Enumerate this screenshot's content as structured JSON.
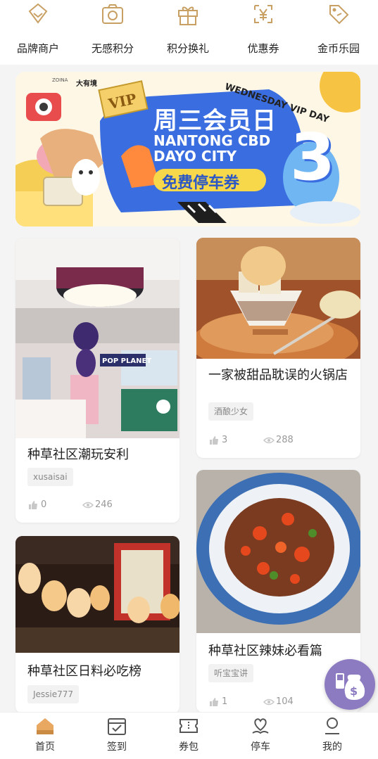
{
  "quick_nav": [
    {
      "label": "品牌商户",
      "icon": "diamond-icon"
    },
    {
      "label": "无感积分",
      "icon": "camera-icon"
    },
    {
      "label": "积分换礼",
      "icon": "gift-icon"
    },
    {
      "label": "优惠券",
      "icon": "yen-coupon-icon"
    },
    {
      "label": "金币乐园",
      "icon": "tag-icon"
    }
  ],
  "banner": {
    "brand_left": "ZOINA",
    "brand_right": "大有境",
    "vip_badge": "VIP",
    "title_cn": "周三会员日",
    "title_en_line1": "NANTONG CBD",
    "title_en_line2": "DAYO CITY",
    "cta": "免费停车券",
    "arc_text": "WEDNESDAY VIP DAY",
    "big_number": "3"
  },
  "posts": [
    {
      "title": "种草社区潮玩安利",
      "author": "xusaisai",
      "likes": "0",
      "views": "246",
      "sign_text": "POP PLANET"
    },
    {
      "title": "一家被甜品耽误的火锅店",
      "author": "酒酿少女",
      "likes": "3",
      "views": "288"
    },
    {
      "title": "种草社区辣妹必看篇",
      "author": "听宝宝讲",
      "likes": "1",
      "views": "104"
    },
    {
      "title": "种草社区日料必吃榜",
      "author": "Jessie777"
    }
  ],
  "tabbar": [
    {
      "label": "首页",
      "active": true
    },
    {
      "label": "签到"
    },
    {
      "label": "券包"
    },
    {
      "label": "停车"
    },
    {
      "label": "我的"
    }
  ],
  "colors": {
    "accent": "#c9a063",
    "fab": "#8d7bc2",
    "banner_blue": "#3a6de0",
    "cta_yellow": "#f6d84a"
  }
}
